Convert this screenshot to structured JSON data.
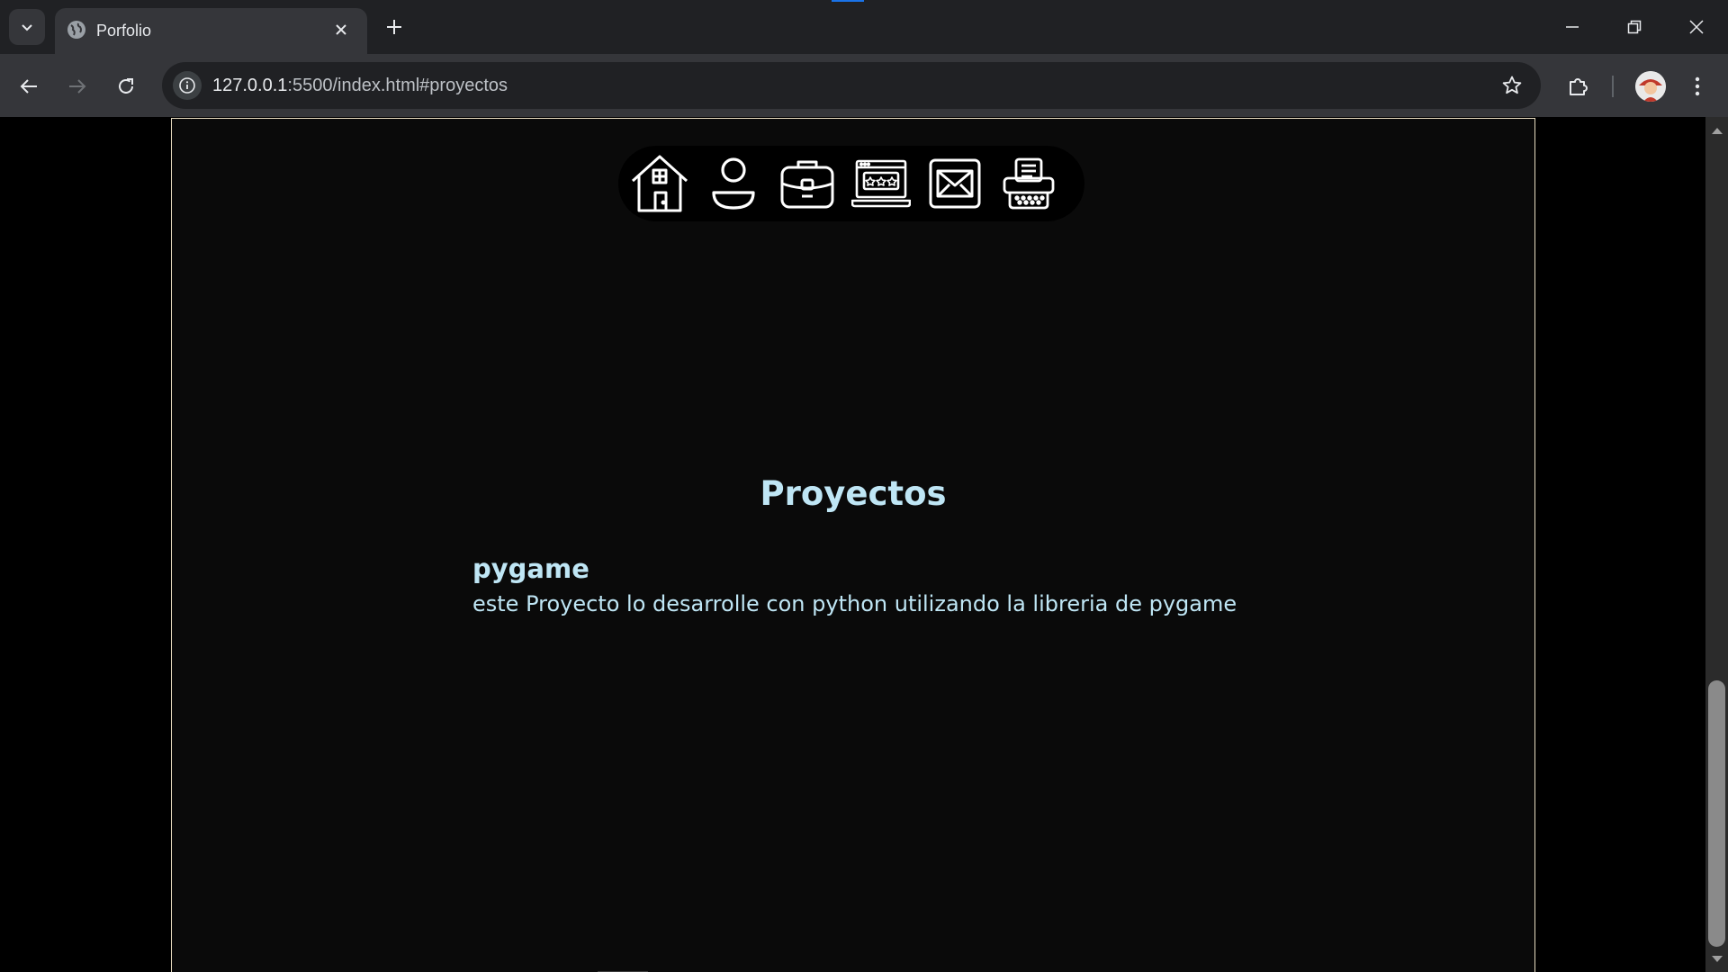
{
  "browser": {
    "tab_title": "Porfolio",
    "url_host": "127.0.0.1",
    "url_rest": ":5500/index.html#proyectos",
    "icons": {
      "tab_search": "chevron-down-icon",
      "favicon": "globe-icon",
      "tab_close": "close-icon",
      "new_tab": "plus-icon",
      "minimize": "minimize-icon",
      "restore": "restore-icon",
      "close": "close-icon",
      "back": "back-arrow-icon",
      "forward": "forward-arrow-icon",
      "reload": "reload-icon",
      "site_info": "info-icon",
      "bookmark": "star-icon",
      "extensions": "puzzle-icon",
      "menu": "kebab-menu-icon"
    }
  },
  "page": {
    "nav_icons": [
      "home-icon",
      "user-icon",
      "briefcase-icon",
      "laptop-rating-icon",
      "mail-icon",
      "typewriter-icon"
    ],
    "section_title": "Proyectos",
    "project": {
      "name": "pygame",
      "description": "este Proyecto lo desarrolle con python utilizando la libreria de pygame"
    },
    "colors": {
      "text_accent": "#bfe6f5",
      "page_background": "#0a0a0a",
      "frame_border": "#e8dcc0",
      "navbar_background": "#000000"
    }
  }
}
